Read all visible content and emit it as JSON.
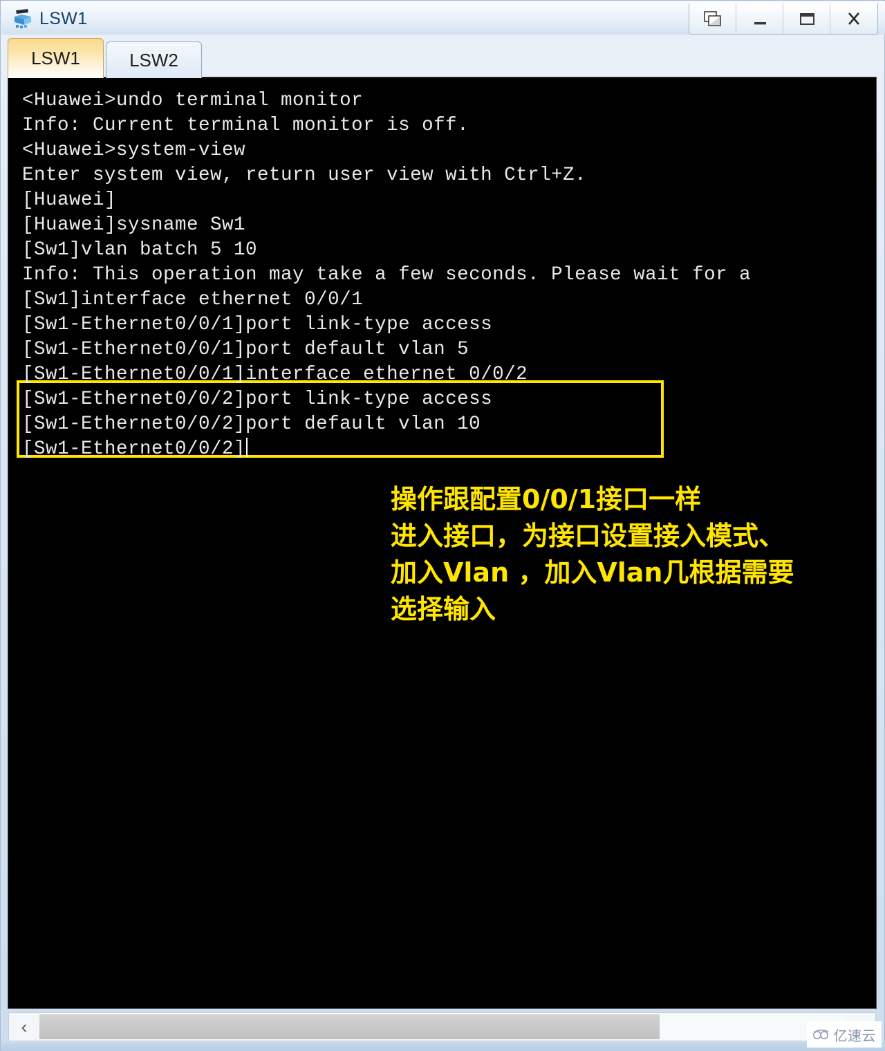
{
  "window": {
    "title": "LSW1",
    "icon": "switch-device-icon",
    "controls": [
      {
        "name": "restore-button",
        "glyph": "cascade-windows-icon"
      },
      {
        "name": "minimize-button",
        "glyph": "minimize-icon"
      },
      {
        "name": "maximize-button",
        "glyph": "maximize-icon"
      },
      {
        "name": "close-button",
        "glyph": "close-icon",
        "label": "X"
      }
    ]
  },
  "tabs": [
    {
      "label": "LSW1",
      "active": true
    },
    {
      "label": "LSW2",
      "active": false
    }
  ],
  "terminal": {
    "background": "#000000",
    "foreground": "#e9e9e9",
    "lines": [
      "<Huawei>undo terminal monitor",
      "Info: Current terminal monitor is off.",
      "<Huawei>system-view",
      "Enter system view, return user view with Ctrl+Z.",
      "[Huawei]",
      "[Huawei]sysname Sw1",
      "[Sw1]vlan batch 5 10",
      "Info: This operation may take a few seconds. Please wait for a",
      "[Sw1]interface ethernet 0/0/1",
      "[Sw1-Ethernet0/0/1]port link-type access",
      "[Sw1-Ethernet0/0/1]port default vlan 5",
      "[Sw1-Ethernet0/0/1]interface ethernet 0/0/2",
      "[Sw1-Ethernet0/0/2]port link-type access",
      "[Sw1-Ethernet0/0/2]port default vlan 10",
      "[Sw1-Ethernet0/0/2]"
    ],
    "cursor_line_index": 14
  },
  "highlight": {
    "color": "#ffe500",
    "covers_lines": [
      11,
      12,
      13
    ]
  },
  "annotation": {
    "color": "#ffe500",
    "lines": [
      "操作跟配置0/0/1接口一样",
      "进入接口，为接口设置接入模式、",
      "加入Vlan ，加入Vlan几根据需要",
      "选择输入"
    ]
  },
  "scrollbar": {
    "left_arrow": "‹",
    "right_arrow": "›",
    "thumb_fraction": 0.77
  },
  "watermark": {
    "text": "亿速云",
    "icon": "cloud-logo-icon"
  }
}
